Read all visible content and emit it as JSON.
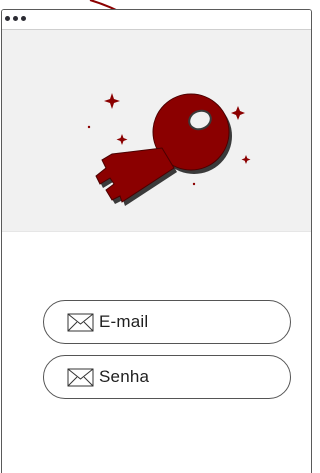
{
  "window": {
    "controls": [
      "dot",
      "dot",
      "dot"
    ]
  },
  "hero": {
    "illustration": "key-icon",
    "decorations": "sparkle-icons",
    "colors": {
      "key": "#8b0000",
      "key_shadow": "#3a3a3a",
      "sparkle": "#8b0000",
      "background": "#f1f1f1"
    }
  },
  "form": {
    "email_placeholder": "E-mail",
    "password_placeholder": "Senha",
    "field_icon": "mail-icon"
  }
}
